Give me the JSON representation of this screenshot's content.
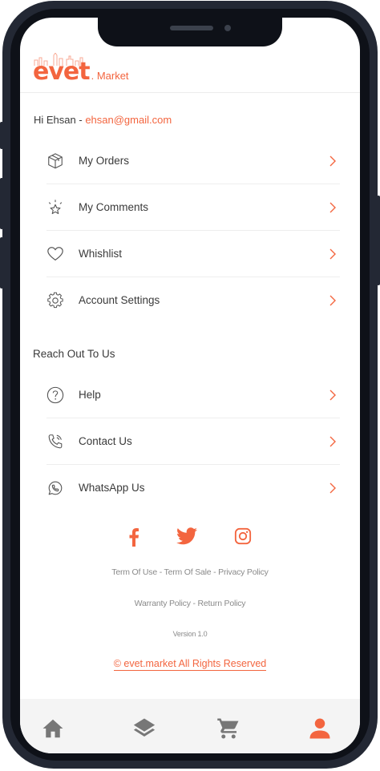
{
  "header": {
    "logo_text": "evet",
    "logo_suffix": ". Market"
  },
  "greeting": {
    "prefix": "Hi Ehsan - ",
    "email": "ehsan@gmail.com"
  },
  "account_menu": [
    {
      "label": "My Orders",
      "icon": "box-icon"
    },
    {
      "label": "My Comments",
      "icon": "star-icon"
    },
    {
      "label": "Whishlist",
      "icon": "heart-icon"
    },
    {
      "label": "Account Settings",
      "icon": "gear-icon"
    }
  ],
  "reach_out": {
    "title": "Reach Out To Us",
    "items": [
      {
        "label": "Help",
        "icon": "question-icon"
      },
      {
        "label": "Contact Us",
        "icon": "phone-icon"
      },
      {
        "label": "WhatsApp Us",
        "icon": "whatsapp-icon"
      }
    ]
  },
  "social": [
    "facebook-icon",
    "twitter-icon",
    "instagram-icon"
  ],
  "footer": {
    "term_of_use": "Term Of Use",
    "term_of_sale": "Term Of Sale",
    "privacy_policy": "Privacy Policy",
    "warranty_policy": "Warranty Policy",
    "return_policy": "Return Policy",
    "separator": " - ",
    "version": "Version 1.0",
    "copyright": "© evet.market All Rights Reserved"
  },
  "bottom_nav": [
    {
      "name": "home",
      "icon": "home-icon",
      "active": false
    },
    {
      "name": "categories",
      "icon": "layers-icon",
      "active": false
    },
    {
      "name": "cart",
      "icon": "cart-icon",
      "active": false
    },
    {
      "name": "profile",
      "icon": "user-icon",
      "active": true
    }
  ],
  "colors": {
    "accent": "#f3653f",
    "text": "#3a3a3a",
    "muted": "#8a8a8a",
    "inactive_icon": "#777777"
  }
}
